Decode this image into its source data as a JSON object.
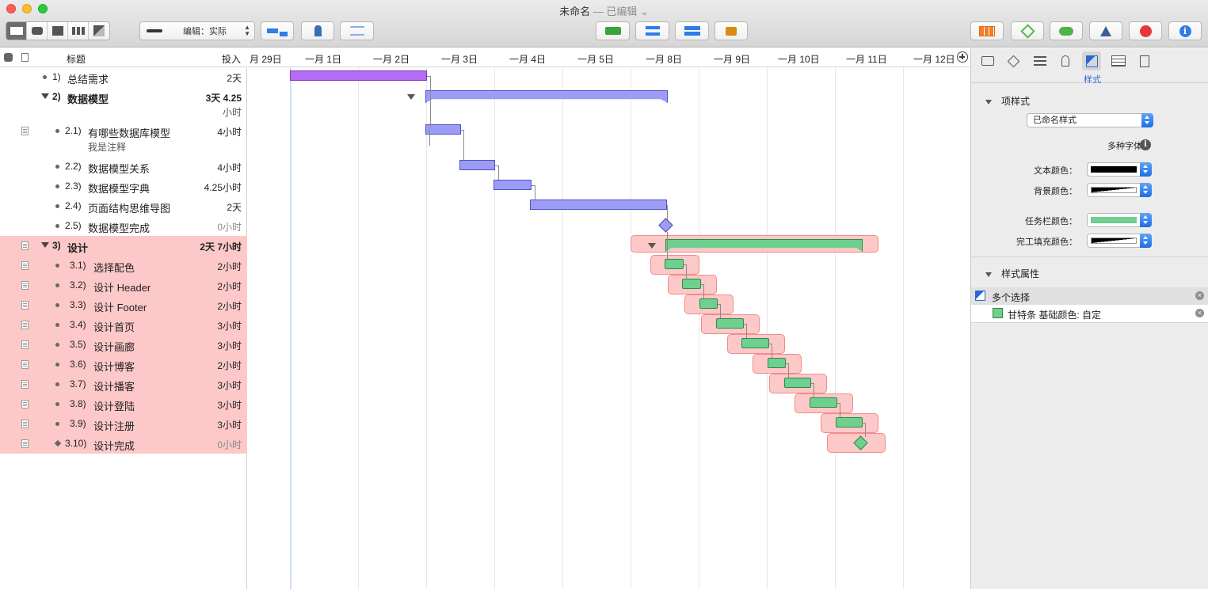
{
  "window": {
    "title": "未命名",
    "subtitle": " — 已编辑 ⌄"
  },
  "toolbar": {
    "edit_mode": "编辑：实际"
  },
  "outline": {
    "col_title": "标题",
    "col_effort": "投入",
    "rows": [
      {
        "num": "1)",
        "title": "总结需求",
        "effort": "2天"
      },
      {
        "num": "2)",
        "title": "数据模型",
        "effort": "3天 4.25",
        "effort2": "小时"
      },
      {
        "num": "2.1)",
        "title": "有哪些数据库模型",
        "effort": "4小时",
        "note": "我是注释"
      },
      {
        "num": "2.2)",
        "title": "数据模型关系",
        "effort": "4小时"
      },
      {
        "num": "2.3)",
        "title": "数据模型字典",
        "effort": "4.25小时"
      },
      {
        "num": "2.4)",
        "title": "页面结构思维导图",
        "effort": "2天"
      },
      {
        "num": "2.5)",
        "title": "数据模型完成",
        "effort": "0小时"
      },
      {
        "num": "3)",
        "title": "设计",
        "effort": "2天 7小时"
      },
      {
        "num": "3.1)",
        "title": "选择配色",
        "effort": "2小时"
      },
      {
        "num": "3.2)",
        "title": "设计 Header",
        "effort": "2小时"
      },
      {
        "num": "3.3)",
        "title": "设计 Footer",
        "effort": "2小时"
      },
      {
        "num": "3.4)",
        "title": "设计首页",
        "effort": "3小时"
      },
      {
        "num": "3.5)",
        "title": "设计画廊",
        "effort": "3小时"
      },
      {
        "num": "3.6)",
        "title": "设计博客",
        "effort": "2小时"
      },
      {
        "num": "3.7)",
        "title": "设计播客",
        "effort": "3小时"
      },
      {
        "num": "3.8)",
        "title": "设计登陆",
        "effort": "3小时"
      },
      {
        "num": "3.9)",
        "title": "设计注册",
        "effort": "3小时"
      },
      {
        "num": "3.10)",
        "title": "设计完成",
        "effort": "0小时"
      }
    ]
  },
  "gantt": {
    "dates": [
      "月 29日",
      "一月 1日",
      "一月 2日",
      "一月 3日",
      "一月 4日",
      "一月 5日",
      "一月 8日",
      "一月 9日",
      "一月 10日",
      "一月 11日",
      "一月 12日"
    ]
  },
  "inspector": {
    "active_tab_label": "样式",
    "section1": "项样式",
    "style_popup": "已命名样式",
    "multi_font": "多种字体",
    "text_color_label": "文本颜色：",
    "bg_color_label": "背景颜色：",
    "taskbar_color_label": "任务栏颜色：",
    "fill_color_label": "完工填充颜色：",
    "section2": "样式属性",
    "multi_select": "多个选择",
    "prop_item": "甘特条 基础颜色: 自定",
    "colors": {
      "text": "#000000",
      "taskbar": "#6fcf8e",
      "bar_blue": "#9c9cf6",
      "bar_purple": "#b46cf3",
      "selection": "#fdc8c8"
    }
  }
}
